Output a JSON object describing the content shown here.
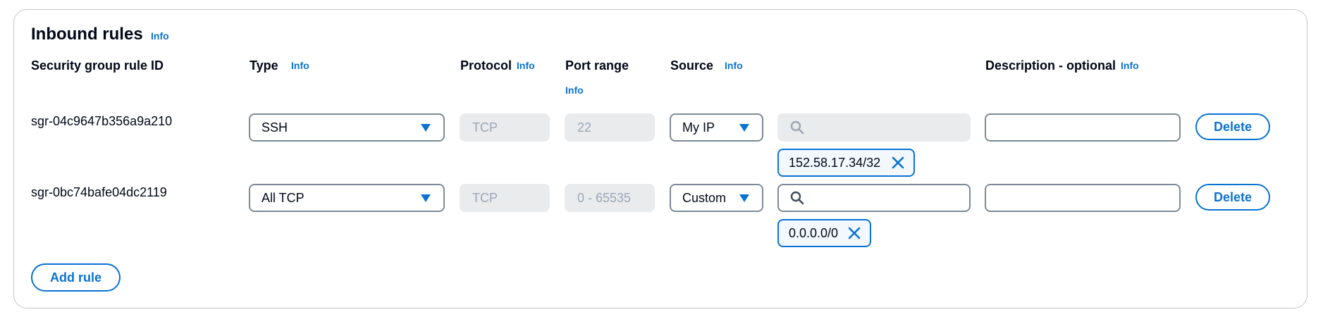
{
  "section": {
    "title": "Inbound rules",
    "info": "Info"
  },
  "columns": {
    "rule_id": "Security group rule ID",
    "type": "Type",
    "type_info": "Info",
    "protocol": "Protocol",
    "protocol_info": "Info",
    "port_range": "Port range",
    "port_range_info": "Info",
    "source": "Source",
    "source_info": "Info",
    "description": "Description - optional",
    "description_info": "Info"
  },
  "rules": [
    {
      "id": "sgr-04c9647b356a9a210",
      "type": "SSH",
      "protocol": "TCP",
      "port_range": "22",
      "source": "My IP",
      "cidr": "152.58.17.34/32",
      "delete_label": "Delete"
    },
    {
      "id": "sgr-0bc74bafe04dc2119",
      "type": "All TCP",
      "protocol": "TCP",
      "port_range": "0 - 65535",
      "source": "Custom",
      "cidr": "0.0.0.0/0",
      "delete_label": "Delete"
    }
  ],
  "actions": {
    "add_rule": "Add rule"
  },
  "colors": {
    "accent": "#0972d3",
    "border": "#7d8998",
    "disabled_bg": "#e9ebed"
  }
}
